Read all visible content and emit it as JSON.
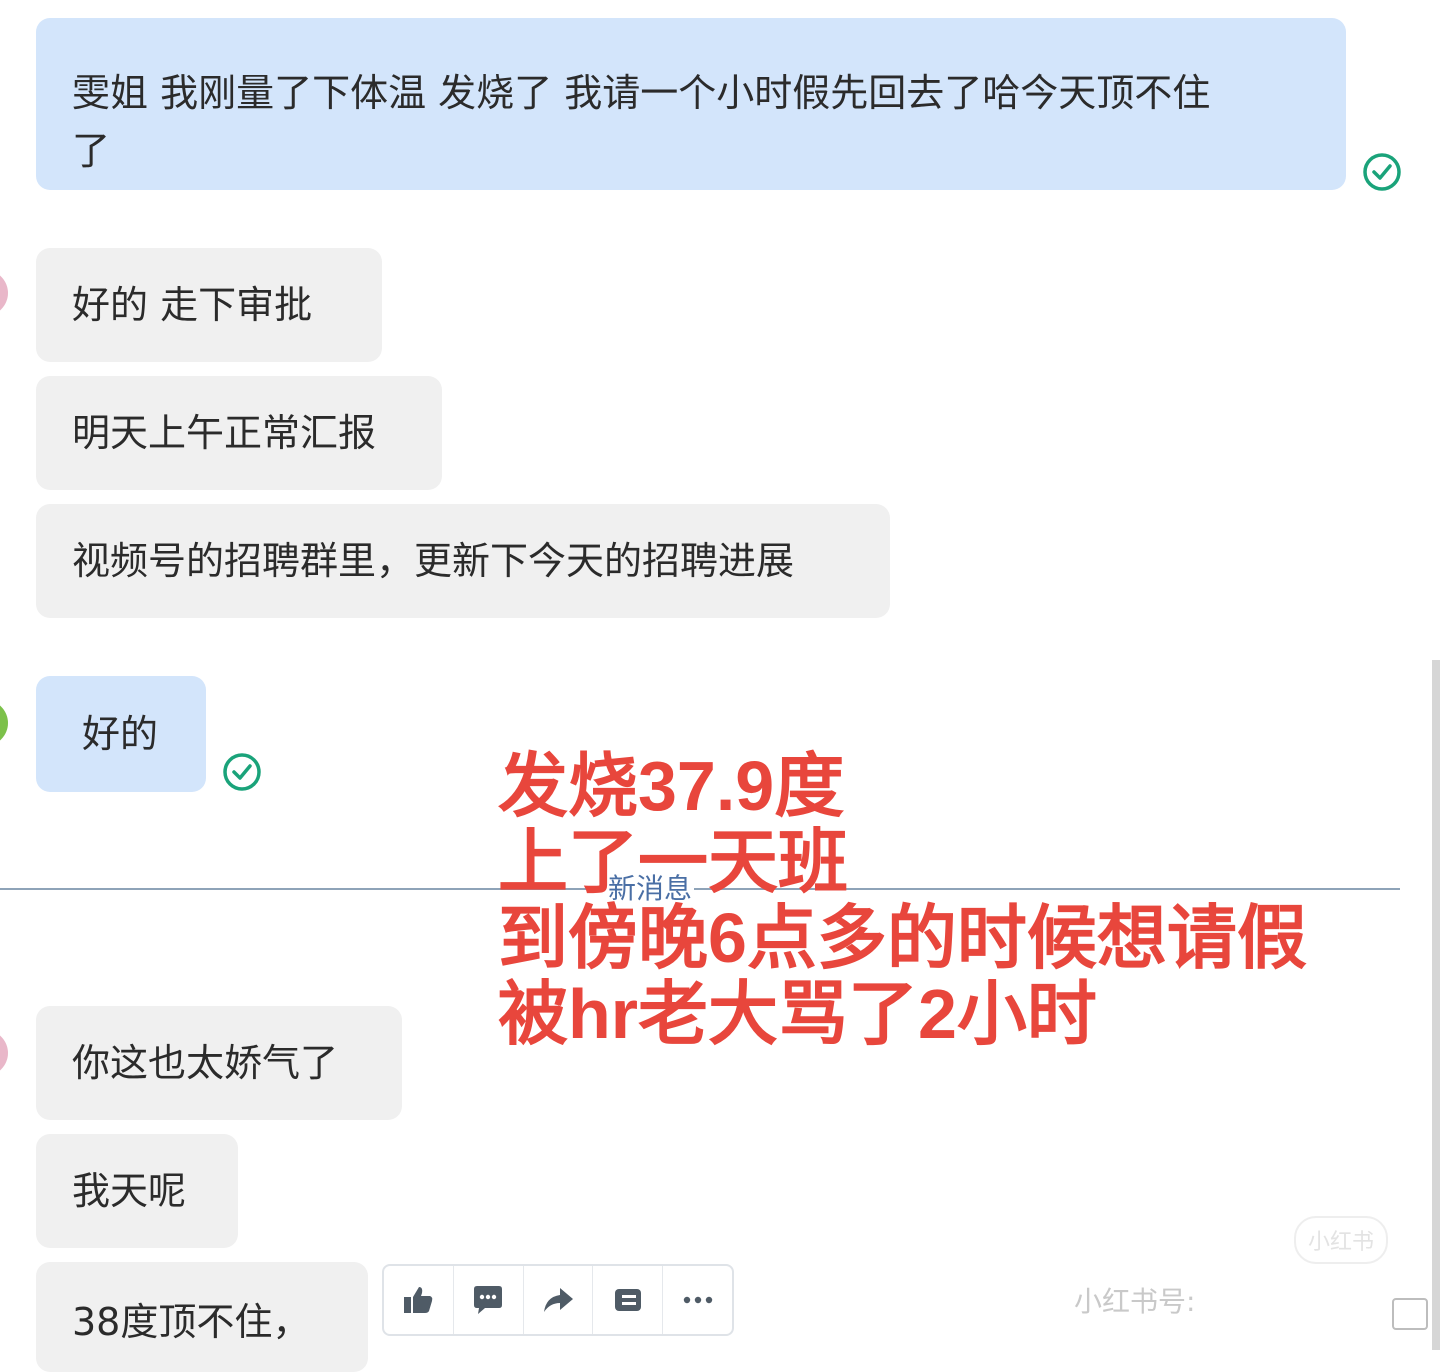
{
  "messages": [
    {
      "lines": [
        "雯姐 我刚量了下体温 发烧了 我请一个小时假先回去了哈今天顶不住",
        "了"
      ]
    },
    {
      "lines": [
        "好的  走下审批"
      ]
    },
    {
      "lines": [
        "明天上午正常汇报"
      ]
    },
    {
      "lines": [
        "视频号的招聘群里，更新下今天的招聘进展"
      ]
    },
    {
      "lines": [
        "好的"
      ]
    },
    {
      "lines": [
        "你这也太娇气了"
      ]
    },
    {
      "lines": [
        "我天呢"
      ]
    },
    {
      "lines": [
        "38度顶不住，"
      ]
    }
  ],
  "divider": {
    "label": "新消息"
  },
  "overlay": {
    "lines": [
      "发烧37.9度",
      "上了一天班",
      "到傍晚6点多的时候想请假",
      "被hr老大骂了2小时"
    ],
    "color": "#e8463c"
  },
  "toolbar": {
    "icons": [
      "thumbs-up-icon",
      "comment-icon",
      "forward-icon",
      "bookmark-icon",
      "more-icon"
    ]
  },
  "watermark": {
    "text": "小红书号:",
    "logo": "小红书"
  },
  "colors": {
    "my_bubble": "#d3e5fb",
    "their_bubble": "#f0f0f0",
    "read_check": "#1aa37a"
  }
}
